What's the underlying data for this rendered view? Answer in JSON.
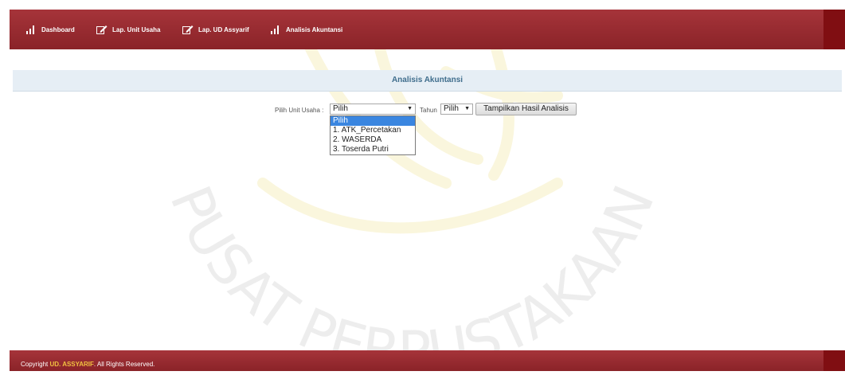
{
  "nav": {
    "items": [
      {
        "label": "Dashboard",
        "icon": "bar-chart-icon"
      },
      {
        "label": "Lap. Unit Usaha",
        "icon": "edit-icon"
      },
      {
        "label": "Lap. UD Assyarif",
        "icon": "edit-icon"
      },
      {
        "label": "Analisis Akuntansi",
        "icon": "bar-chart-icon"
      }
    ]
  },
  "page": {
    "section_title": "Analisis Akuntansi"
  },
  "form": {
    "unit_label": "Pilih Unit Usaha :",
    "unit_value": "Pilih",
    "year_label": "Tahun",
    "year_value": "Pilih",
    "submit_label": "Tampilkan Hasil Analisis",
    "unit_options": [
      "Pilih",
      "1. ATK_Percetakan",
      "2. WASERDA",
      "3. Toserda Putri"
    ]
  },
  "footer": {
    "prefix": "Copyright",
    "brand": "UD. ASSYARIF",
    "suffix": ". All Rights Reserved."
  },
  "watermark": {
    "text": "PUSAT PERPUSTAKAAN"
  },
  "colors": {
    "nav_bg": "#a6343a",
    "accent_blue": "#3a86e0",
    "section_text": "#3f6d8c"
  }
}
